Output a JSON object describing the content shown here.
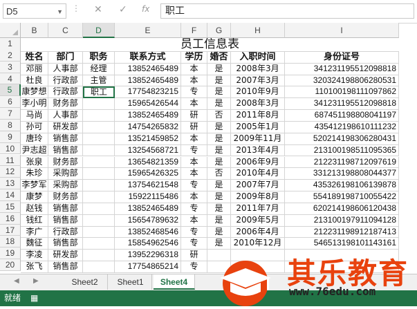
{
  "formula_bar": {
    "name_box": "D5",
    "formula": "职工",
    "cancel_glyph": "✕",
    "enter_glyph": "✓",
    "fx_label": "fx"
  },
  "columns": [
    "B",
    "C",
    "D",
    "E",
    "F",
    "G",
    "H",
    "I"
  ],
  "active_cell": "D5",
  "title": "员工信息表",
  "headers": [
    "姓名",
    "部门",
    "职务",
    "联系方式",
    "学历",
    "婚否",
    "入职时间",
    "身份证号"
  ],
  "rows": [
    {
      "row": "3",
      "cells": [
        "邓丽",
        "人事部",
        "经理",
        "13852465489",
        "本",
        "是",
        "2008年3月",
        "341231195512098818"
      ]
    },
    {
      "row": "4",
      "cells": [
        "杜良",
        "行政部",
        "主管",
        "13852465489",
        "本",
        "是",
        "2007年3月",
        "320324198806280531"
      ]
    },
    {
      "row": "5",
      "cells": [
        "康梦想",
        "行政部",
        "职工",
        "17754823215",
        "专",
        "是",
        "2010年9月",
        "110100198111097862"
      ]
    },
    {
      "row": "6",
      "cells": [
        "李小明",
        "财务部",
        "",
        "15965426544",
        "本",
        "是",
        "2008年3月",
        "341231195512098818"
      ]
    },
    {
      "row": "7",
      "cells": [
        "马尚",
        "人事部",
        "",
        "13852465489",
        "研",
        "否",
        "2011年8月",
        "687451198808041197"
      ]
    },
    {
      "row": "8",
      "cells": [
        "孙可",
        "研发部",
        "",
        "14754265832",
        "研",
        "是",
        "2005年1月",
        "435412198610111232"
      ]
    },
    {
      "row": "9",
      "cells": [
        "唐玲",
        "销售部",
        "",
        "13521459852",
        "本",
        "是",
        "2009年11月",
        "520214198306280431"
      ]
    },
    {
      "row": "10",
      "cells": [
        "尹志超",
        "销售部",
        "",
        "13254568721",
        "专",
        "是",
        "2013年4月",
        "213100198511095365"
      ]
    },
    {
      "row": "11",
      "cells": [
        "张泉",
        "财务部",
        "",
        "13654821359",
        "本",
        "是",
        "2006年9月",
        "212231198712097619"
      ]
    },
    {
      "row": "12",
      "cells": [
        "朱珍",
        "采购部",
        "",
        "15965426325",
        "本",
        "否",
        "2010年4月",
        "331213198808044377"
      ]
    },
    {
      "row": "13",
      "cells": [
        "李梦军",
        "采购部",
        "",
        "13754621548",
        "专",
        "是",
        "2007年7月",
        "435326198106139878"
      ]
    },
    {
      "row": "14",
      "cells": [
        "康梦",
        "财务部",
        "",
        "15922115486",
        "本",
        "是",
        "2009年8月",
        "554189198710055422"
      ]
    },
    {
      "row": "15",
      "cells": [
        "赵钱",
        "销售部",
        "",
        "13852465489",
        "专",
        "是",
        "2011年7月",
        "620214198606120438"
      ]
    },
    {
      "row": "16",
      "cells": [
        "钱红",
        "销售部",
        "",
        "15654789632",
        "本",
        "是",
        "2009年5月",
        "213100197911094128"
      ]
    },
    {
      "row": "17",
      "cells": [
        "李广",
        "行政部",
        "",
        "13852468546",
        "专",
        "是",
        "2006年4月",
        "212231198912187413"
      ]
    },
    {
      "row": "18",
      "cells": [
        "魏征",
        "销售部",
        "",
        "15854962546",
        "专",
        "是",
        "2010年12月",
        "546513198101143161"
      ]
    },
    {
      "row": "19",
      "cells": [
        "李凌",
        "研发部",
        "",
        "13952296318",
        "研",
        "",
        "",
        ""
      ]
    },
    {
      "row": "20",
      "cells": [
        "张飞",
        "销售部",
        "",
        "17754865214",
        "专",
        "",
        "",
        ""
      ]
    }
  ],
  "sheet_tabs": [
    "Sheet2",
    "Sheet1",
    "Sheet4"
  ],
  "active_tab": "Sheet4",
  "status_text": "就绪",
  "watermark": {
    "brand": "其乐教育",
    "url": "www.76edu.com"
  },
  "colors": {
    "accent": "#217346",
    "watermark": "#e8420e"
  }
}
